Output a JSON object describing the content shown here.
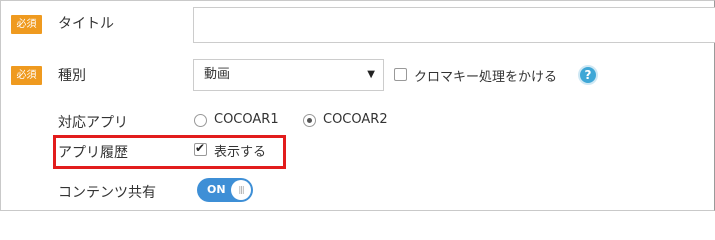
{
  "required_badge": "必須",
  "title_field": {
    "label": "タイトル",
    "value": ""
  },
  "type_field": {
    "label": "種別",
    "selected": "動画",
    "chroma_key_label": "クロマキー処理をかける",
    "chroma_key_checked": false,
    "help_glyph": "?"
  },
  "app_field": {
    "label": "対応アプリ",
    "options": [
      {
        "label": "COCOAR1",
        "checked": false
      },
      {
        "label": "COCOAR2",
        "checked": true
      }
    ]
  },
  "history_field": {
    "label": "アプリ履歴",
    "checkbox_label": "表示する",
    "checked": true
  },
  "share_field": {
    "label": "コンテンツ共有",
    "toggle_label": "ON",
    "toggle_knob": "|||"
  },
  "colors": {
    "badge": "#ef9a1f",
    "highlight": "#e21c1c",
    "toggle": "#3e8fd6",
    "help": "#3fa7d6"
  }
}
